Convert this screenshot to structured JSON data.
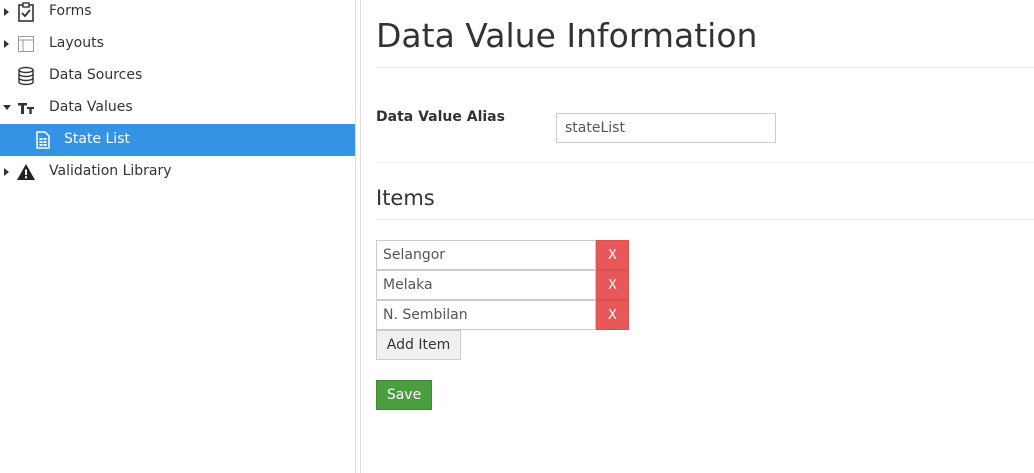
{
  "sidebar": {
    "items": [
      {
        "label": "Forms",
        "icon": "clipboard-check-icon",
        "caret": "collapsed"
      },
      {
        "label": "Layouts",
        "icon": "layout-icon",
        "caret": "collapsed"
      },
      {
        "label": "Data Sources",
        "icon": "database-icon",
        "caret": "none"
      },
      {
        "label": "Data Values",
        "icon": "text-size-icon",
        "caret": "expanded"
      },
      {
        "label": "State List",
        "icon": "document-list-icon",
        "selected": true
      },
      {
        "label": "Validation Library",
        "icon": "warning-icon",
        "caret": "collapsed"
      }
    ]
  },
  "main": {
    "title": "Data Value Information",
    "alias_label": "Data Value Alias",
    "alias_value": "stateList",
    "items_title": "Items",
    "items": [
      {
        "value": "Selangor",
        "remove_label": "X"
      },
      {
        "value": "Melaka",
        "remove_label": "X"
      },
      {
        "value": "N. Sembilan",
        "remove_label": "X"
      }
    ],
    "add_item_label": "Add Item",
    "save_label": "Save"
  },
  "colors": {
    "selected": "#3593e6",
    "remove": "#e8585a",
    "save": "#4a9e3f"
  }
}
